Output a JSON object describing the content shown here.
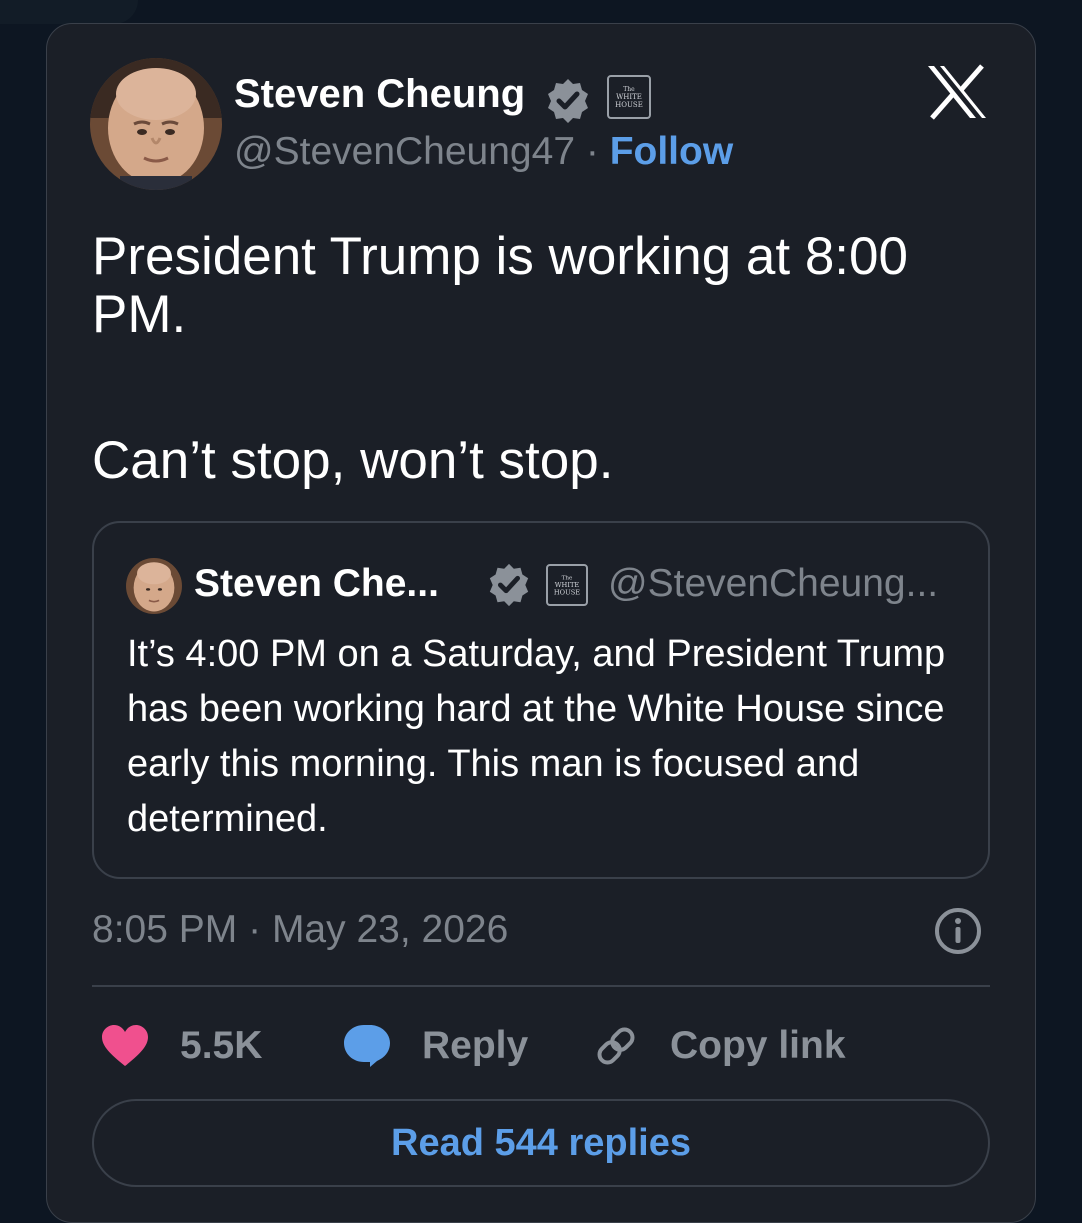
{
  "tweet": {
    "author_name": "Steven Cheung",
    "handle": "@StevenCheung47",
    "separator": "·",
    "follow_label": "Follow",
    "badge_text": "THE WHITE HOUSE",
    "body_paragraphs": [
      "President Trump is working at 8:00 PM.",
      "Can’t stop, won’t stop."
    ],
    "time": "8:05 PM",
    "date": "May 23, 2026",
    "likes": "5.5K",
    "reply_label": "Reply",
    "copy_link_label": "Copy link",
    "read_replies_label": "Read 544 replies"
  },
  "quoted": {
    "author_name": "Steven Che...",
    "handle": "@StevenCheung...",
    "text": "It’s 4:00 PM on a Saturday, and President Trump has been working hard at the White House since early this morning. This man is focused and determined."
  },
  "icons": {
    "verified": "verified-badge-icon",
    "platform_logo": "x-logo-icon",
    "info": "info-icon",
    "like": "heart-icon",
    "reply": "speech-bubble-icon",
    "copy_link": "link-icon"
  },
  "colors": {
    "background": "#0d1622",
    "card": "#1b1f27",
    "accent_blue": "#5c9ee8",
    "heart_pink": "#f0508e",
    "muted_text": "#7e848c"
  }
}
